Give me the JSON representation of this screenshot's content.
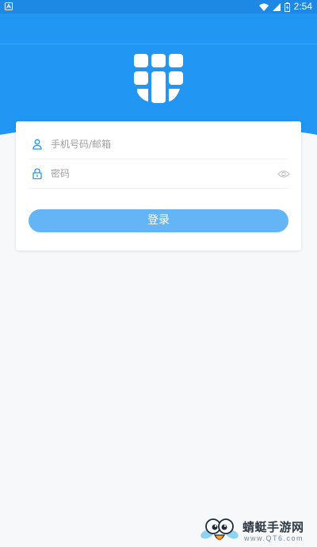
{
  "status_bar": {
    "time": "2:54",
    "icons": [
      "notification-icon",
      "wifi-icon",
      "signal-icon",
      "battery-icon"
    ]
  },
  "login": {
    "phone_placeholder": "手机号码/邮箱",
    "password_placeholder": "密码",
    "submit_label": "登录"
  },
  "watermark": {
    "title": "蜻蜓手游网",
    "url": "www.QT6.com"
  },
  "colors": {
    "status_bar": "#1e88e5",
    "primary": "#2196f3",
    "button": "#64b5f6",
    "icon_accent": "#2196f3",
    "background": "#f7f8fa"
  }
}
